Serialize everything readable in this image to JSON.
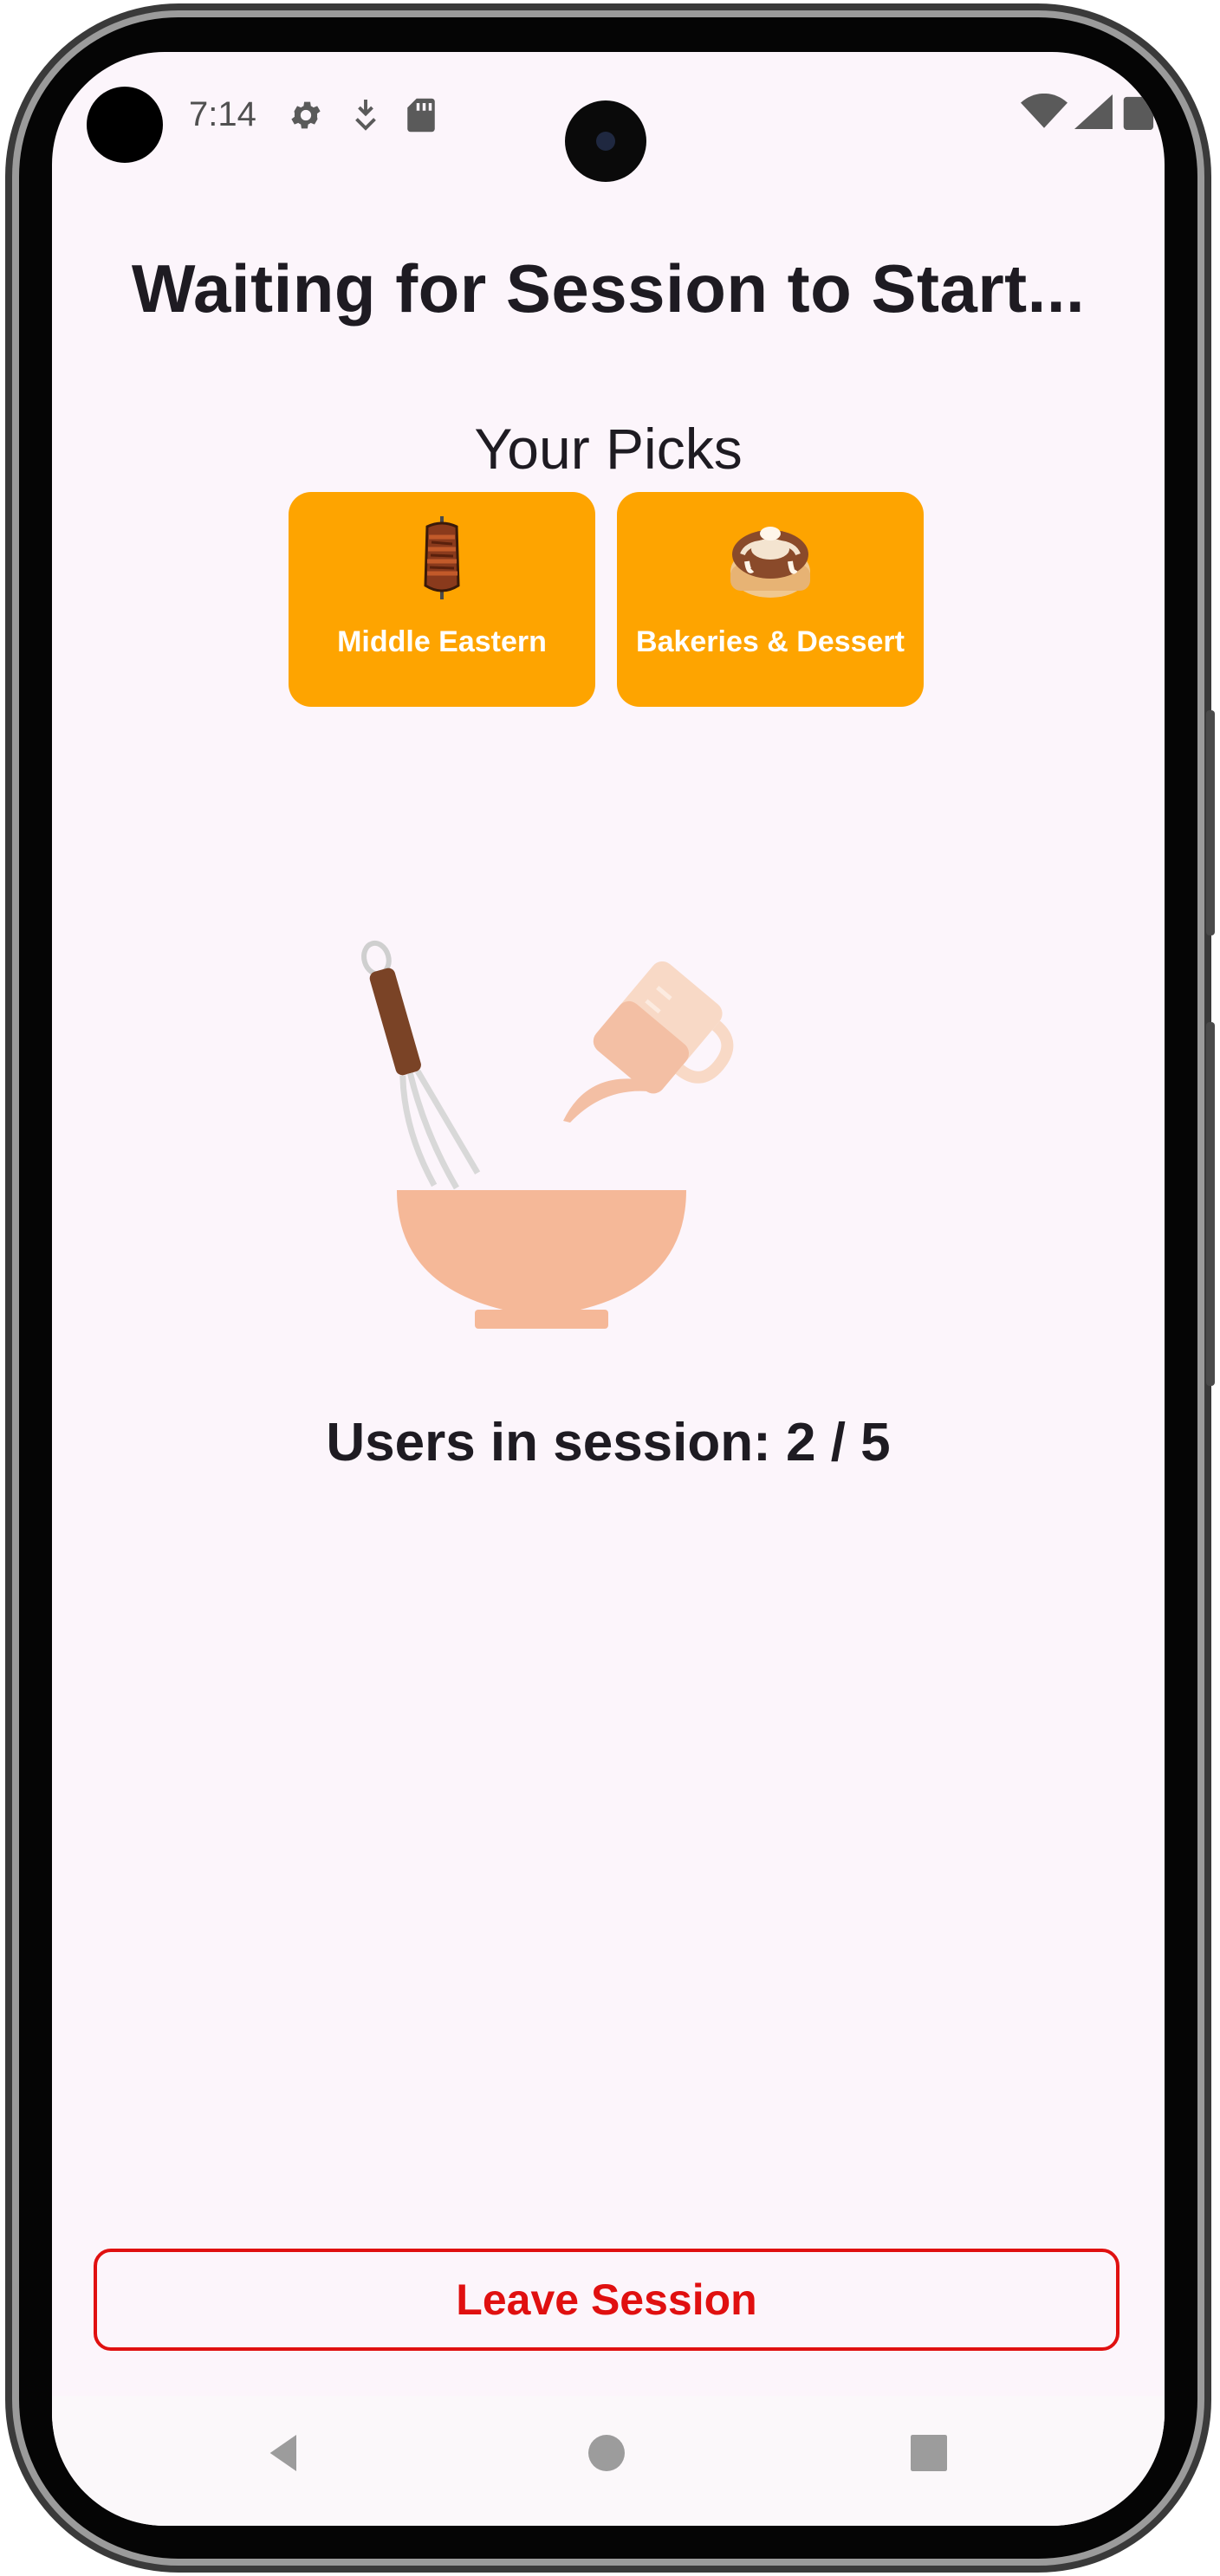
{
  "status_bar": {
    "time": "7:14",
    "left_icons": [
      "gear-icon",
      "download-check-icon",
      "sd-card-icon"
    ],
    "right_icons": [
      "wifi-icon",
      "cell-signal-icon",
      "battery-icon"
    ]
  },
  "page": {
    "title": "Waiting for Session to Start...",
    "picks_heading": "Your Picks"
  },
  "picks": [
    {
      "label": "Middle Eastern",
      "icon": "shawarma-icon"
    },
    {
      "label": "Bakeries & Dessert",
      "icon": "cinnamon-roll-icon"
    }
  ],
  "illustration": {
    "icon": "mixing-bowl-whisk-icon"
  },
  "session": {
    "users_text": "Users in session: 2 / 5"
  },
  "actions": {
    "leave_label": "Leave Session"
  },
  "nav": {
    "items": [
      "back-icon",
      "home-icon",
      "recents-icon"
    ]
  },
  "colors": {
    "pick_background": "#fea400",
    "leave_accent": "#e01010",
    "screen_background": "#fcf5fb",
    "text": "#1e1b22"
  }
}
